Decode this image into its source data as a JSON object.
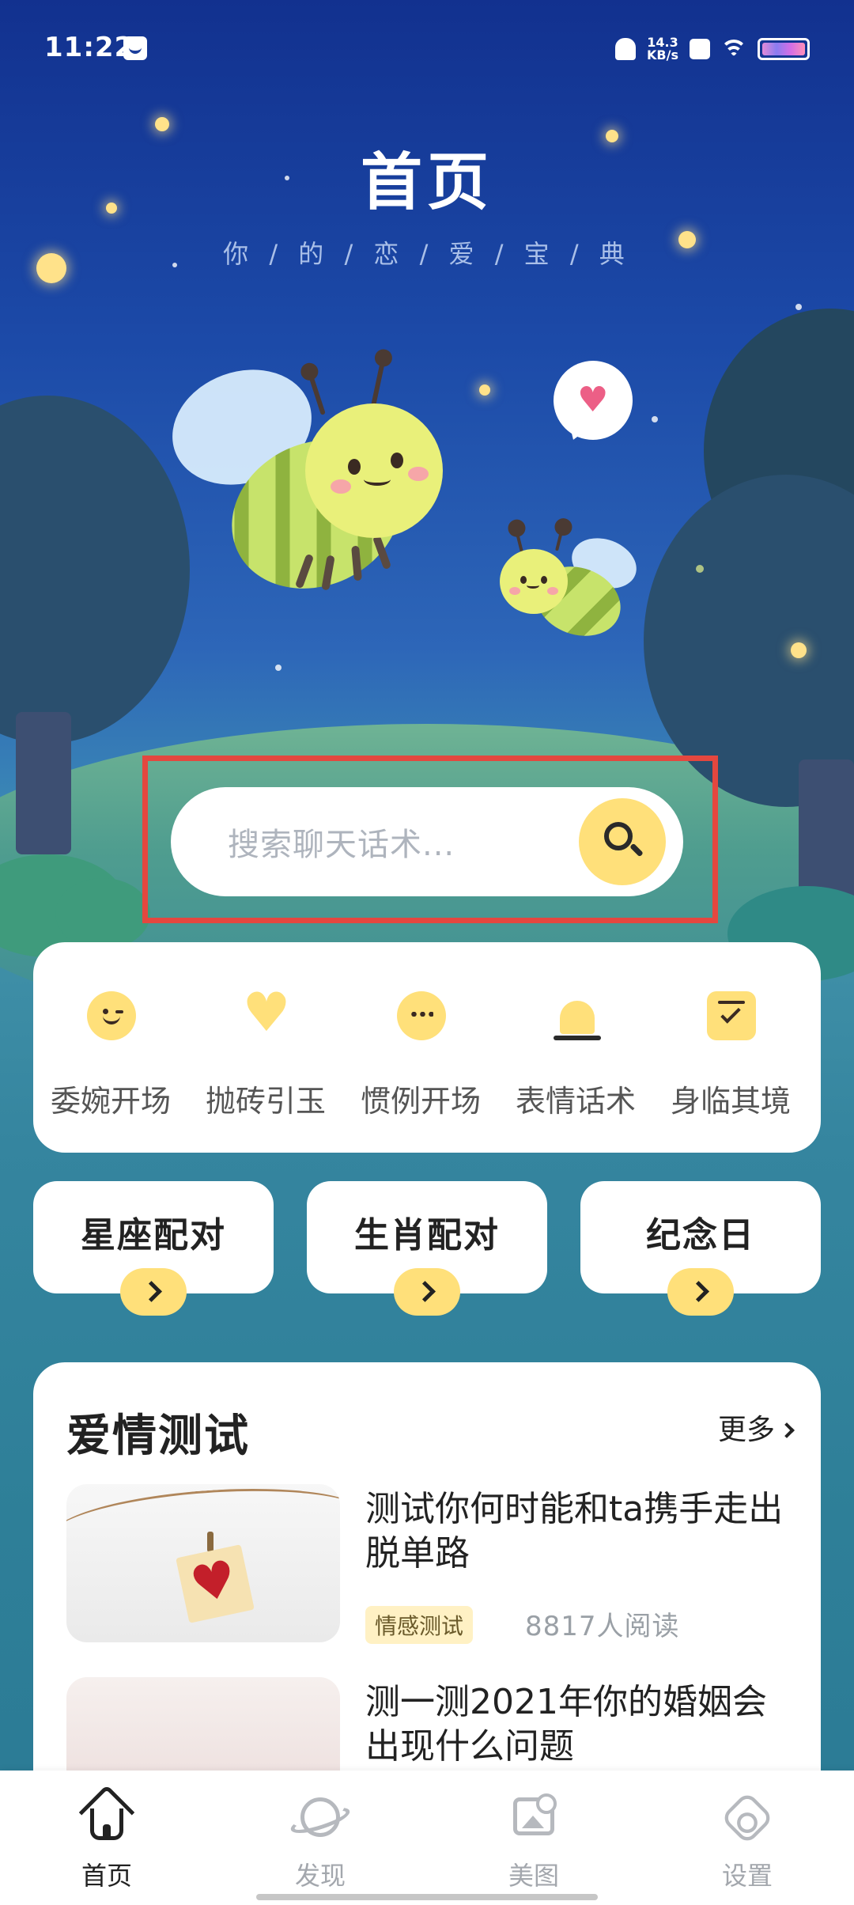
{
  "status_bar": {
    "time": "11:22",
    "network_speed_value": "14.3",
    "network_speed_unit": "KB/s"
  },
  "header": {
    "title": "首页",
    "subtitle": "你 / 的 / 恋 / 爱 / 宝 / 典"
  },
  "search": {
    "placeholder": "搜索聊天话术..."
  },
  "categories": [
    {
      "label": "委婉开场",
      "icon": "wink-face-icon"
    },
    {
      "label": "抛砖引玉",
      "icon": "heart-icon"
    },
    {
      "label": "惯例开场",
      "icon": "chat-dots-icon"
    },
    {
      "label": "表情话术",
      "icon": "alert-bell-icon"
    },
    {
      "label": "身临其境",
      "icon": "checklist-icon"
    }
  ],
  "match_buttons": [
    {
      "label": "星座配对"
    },
    {
      "label": "生肖配对"
    },
    {
      "label": "纪念日"
    }
  ],
  "love_test": {
    "title": "爱情测试",
    "more_label": "更多",
    "articles": [
      {
        "title": "测试你何时能和ta携手走出脱单路",
        "tag": "情感测试",
        "reads": "8817人阅读"
      },
      {
        "title": "测一测2021年你的婚姻会出现什么问题"
      }
    ]
  },
  "tabbar": {
    "tabs": [
      {
        "label": "首页",
        "icon": "home-icon",
        "active": true
      },
      {
        "label": "发现",
        "icon": "planet-icon",
        "active": false
      },
      {
        "label": "美图",
        "icon": "image-icon",
        "active": false
      },
      {
        "label": "设置",
        "icon": "settings-icon",
        "active": false
      }
    ]
  },
  "colors": {
    "accent_yellow": "#ffe07a",
    "highlight_frame": "#e4473f",
    "sky_top": "#12318f"
  }
}
